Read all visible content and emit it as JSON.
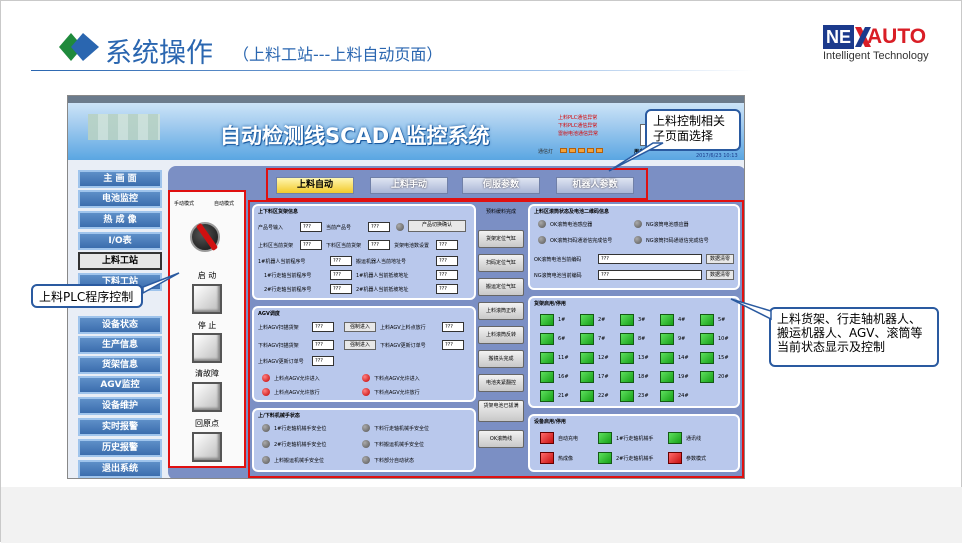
{
  "slide": {
    "title": "系统操作",
    "subtitle": "（上料工站---上料自动页面）",
    "brand_ne": "NE",
    "brand_auto": "AUTO",
    "brand_tagline": "Intelligent Technology",
    "colors": {
      "title_blue": "#2a66b0",
      "brand_red": "#d91e26",
      "brand_navy": "#1b3a8c"
    }
  },
  "app": {
    "title": "自动检测线SCADA监控系统",
    "alarm_lines": [
      "上料PLC通信异常",
      "下料PLC通信异常",
      "雷射电池通信异常"
    ],
    "comm_label": "通信灯",
    "user_label": "用户",
    "time": "2017/6/23 10:13"
  },
  "nav": {
    "items": [
      "主 画 面",
      "电池监控",
      "热 成 像",
      "I/O表",
      "上料工站",
      "下料工站",
      "设备状态",
      "生产信息",
      "货架信息",
      "AGV监控",
      "设备维护",
      "实时报警",
      "历史报警",
      "退出系统"
    ]
  },
  "tabs": [
    "上料自动",
    "上料手动",
    "伺服参数",
    "机器人参数"
  ],
  "left_control": {
    "manual_mode": "手动模式",
    "auto_mode": "自动模式",
    "start": "启 动",
    "stop": "停 止",
    "clear_fault": "清故障",
    "home": "回原点"
  },
  "up_down_panel": {
    "title": "上下料区货架信息",
    "product_no_label": "产品号输入",
    "current_product_label": "当前产品号",
    "switch_confirm": "产品切换确认",
    "rows": [
      [
        "上料区当前货架",
        "下料区当前货架",
        "货架电池数设置"
      ],
      [
        "1#机器人当前程序号",
        "搬运机器人当前地址号"
      ],
      [
        "1#行走轴当前程序号",
        "1#机器人当前抵坡地址"
      ],
      [
        "2#行走轴当前程序号",
        "2#机器人当前抵坡地址"
      ]
    ],
    "value": "???"
  },
  "agv_panel": {
    "title": "AGV调度",
    "up_agv_line": "上料AGV扫描货架",
    "up_agv_enter": "上料AGV上料点放行",
    "down_agv_line": "下料AGV扫描货架",
    "down_agv_enter": "下料AGV更新订单号",
    "force_in": "强制进入",
    "agv_order": "上料AGV更新订单号",
    "lights": [
      "上料点AGV允许进入",
      "下料点AGV允许进入",
      "上料点AGV允许放行",
      "下料点AGV允许放行"
    ],
    "value": "???"
  },
  "mech_panel": {
    "title": "上/下料机械手状态",
    "items": [
      "1#行走轴机械手安全位",
      "下料行走轴机械手安全位",
      "2#行走轴机械手安全位",
      "下料搬运机械手安全位",
      "上料搬运机械手安全位",
      "下料部分自动状态"
    ]
  },
  "mid_buttons": [
    "预料缓料完成",
    "货架定位气缸",
    "扫码定位气缸",
    "搬运定位气缸",
    "上料滚筒正转",
    "上料滚筒反转",
    "搬镜头完成",
    "电池夹紧翻控",
    "货架电池已拔满",
    "OK滚筒线"
  ],
  "scan_panel": {
    "title": "上料区滚筒状态及电池二维码信息",
    "sensors": [
      "OK滚筒电池感应器",
      "NG滚筒电池感应器",
      "OK滚筒扫码通道信完成信号",
      "NG滚筒扫码通道信完成信号"
    ],
    "ok_code_label": "OK滚筒电池当前编码",
    "ng_code_label": "NG滚筒电池当前编码",
    "clear": "数据清零",
    "value": "???"
  },
  "rack_panel": {
    "title": "货架启用/停用",
    "slots": [
      "1#",
      "2#",
      "3#",
      "4#",
      "5#",
      "6#",
      "7#",
      "8#",
      "9#",
      "10#",
      "11#",
      "12#",
      "13#",
      "14#",
      "15#",
      "16#",
      "17#",
      "18#",
      "19#",
      "20#",
      "21#",
      "22#",
      "23#",
      "24#"
    ]
  },
  "device_panel": {
    "title": "设备启用/停用",
    "items": [
      "自动充电",
      "1#行走轴机械手",
      "通讯线",
      "热成像",
      "2#行走轴机械手",
      "参数模式"
    ]
  },
  "callouts": {
    "tab_select": "上料控制相关子页面选择",
    "plc_control": "上料PLC程序控制",
    "status_display": "上料货架、行走轴机器人、搬运机器人、AGV、滚筒等当前状态显示及控制"
  }
}
